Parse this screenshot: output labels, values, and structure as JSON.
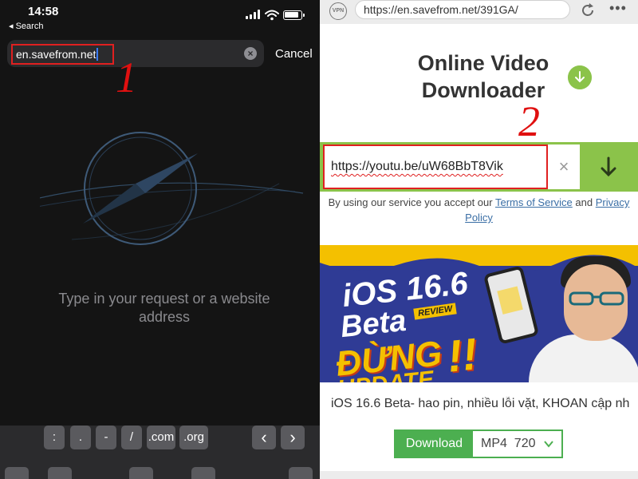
{
  "left": {
    "status": {
      "time": "14:58",
      "back_label": "◂ Search"
    },
    "url_bar": {
      "value": "en.savefrom.net",
      "clear_glyph": "×",
      "cancel_label": "Cancel"
    },
    "step_label": "1",
    "empty_message": "Type in your request or a website address",
    "keyboard": {
      "keys": [
        ":",
        ".",
        "-",
        "/",
        ".com",
        ".org"
      ],
      "prev": "‹",
      "next": "›"
    }
  },
  "right": {
    "browser": {
      "vpn_label": "VPN",
      "url": "https://en.savefrom.net/391GA/",
      "more_glyph": "•••"
    },
    "page_title": "Online Video Downloader",
    "step_label": "2",
    "input": {
      "value": "https://youtu.be/uW68BbT8Vik",
      "clear_glyph": "×"
    },
    "terms": {
      "prefix": "By using our service you accept our",
      "tos_link": "Terms of Service",
      "and": "and",
      "privacy_link": "Privacy Policy"
    },
    "thumbnail": {
      "line1": "iOS 16.6",
      "line2": "Beta",
      "badge": "REVIEW",
      "line3": "ĐỪNG",
      "line4": "UPDATE",
      "exclaim": "!!"
    },
    "video_title": "iOS 16.6 Beta- hao pin, nhiều lỗi vặt, KHOAN cập nh...",
    "download": {
      "label": "Download",
      "format": "MP4",
      "quality": "720"
    }
  },
  "colors": {
    "accent_green": "#8bc34a",
    "download_green": "#4caf50",
    "highlight_red": "#e02020",
    "link_blue": "#3a6ea5"
  }
}
